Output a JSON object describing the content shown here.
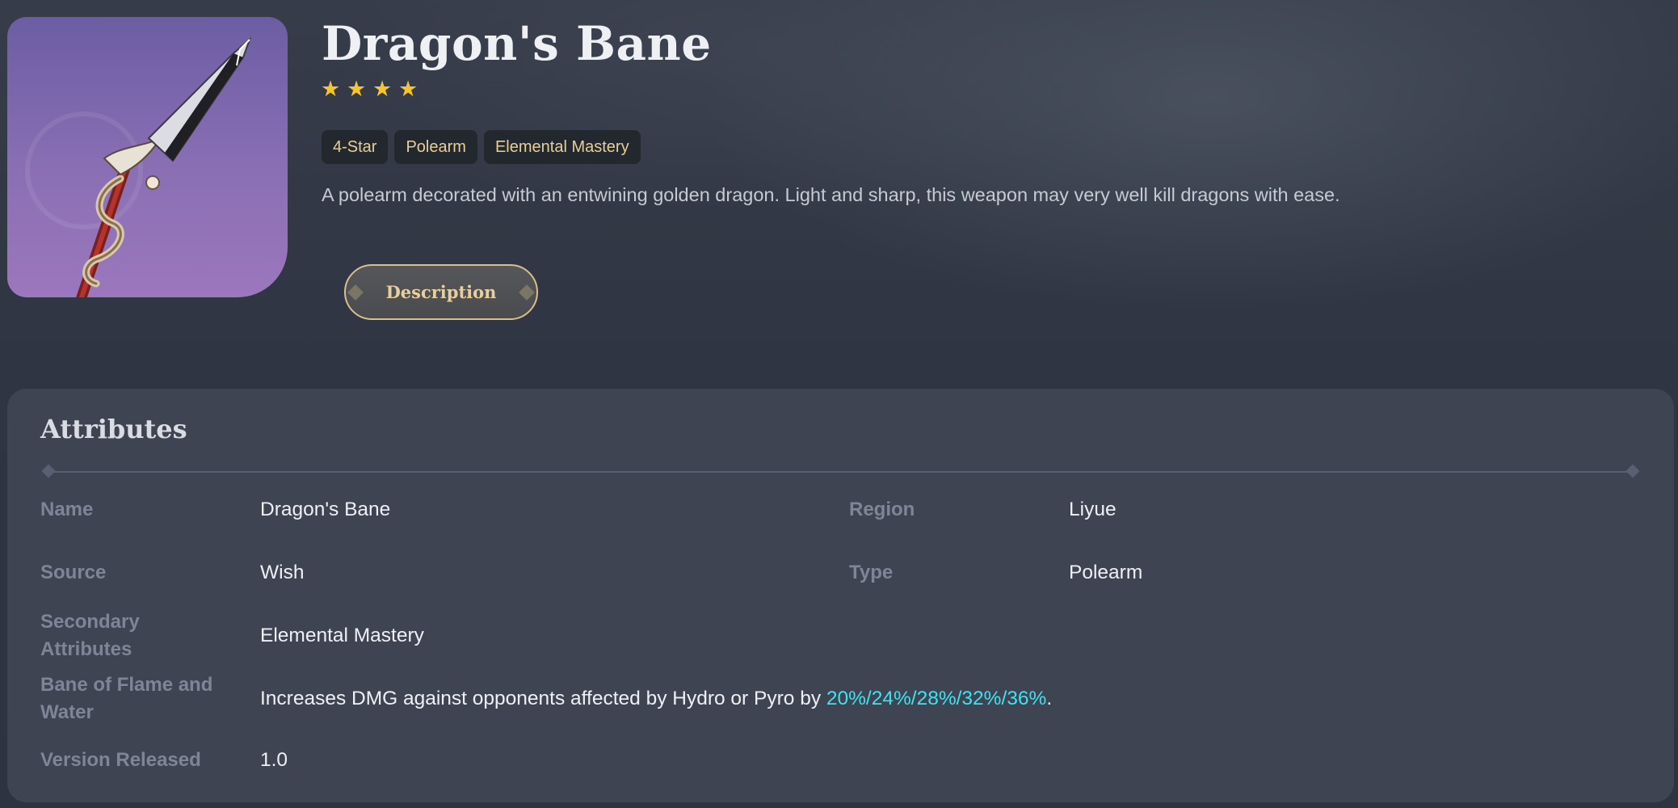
{
  "weapon": {
    "name": "Dragon's Bane",
    "rarity_stars": 4,
    "tags": [
      "4-Star",
      "Polearm",
      "Elemental Mastery"
    ],
    "summary": "A polearm decorated with an entwining golden dragon. Light and sharp, this weapon may very well kill dragons with ease.",
    "description_button": "Description"
  },
  "attributes": {
    "title": "Attributes",
    "name_label": "Name",
    "name_value": "Dragon's Bane",
    "region_label": "Region",
    "region_value": "Liyue",
    "source_label": "Source",
    "source_value": "Wish",
    "type_label": "Type",
    "type_value": "Polearm",
    "secondary_label_1": "Secondary",
    "secondary_label_2": "Attributes",
    "secondary_value": "Elemental Mastery",
    "passive_label_1": "Bane of Flame and",
    "passive_label_2": "Water",
    "passive_text_before": "Increases DMG against opponents affected by Hydro or Pyro by ",
    "passive_highlight": "20%/24%/28%/32%/36%",
    "passive_text_after": ".",
    "version_label": "Version Released",
    "version_value": "1.0"
  },
  "colors": {
    "star": "#f6c331",
    "tag_text": "#e6cf9b",
    "highlight": "#3fe3ef",
    "panel_bg": "#3f4453"
  },
  "icons": {
    "star": "star-icon",
    "weapon": "polearm-weapon-icon"
  }
}
